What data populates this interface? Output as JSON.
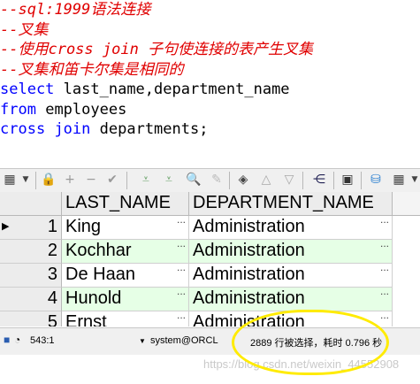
{
  "editor": {
    "lines": [
      {
        "text": "--sql:1999语法连接",
        "style": "comment"
      },
      {
        "text": "--叉集",
        "style": "comment"
      },
      {
        "text": "--使用cross join 子句使连接的表产生叉集",
        "style": "comment"
      },
      {
        "text": "--叉集和笛卡尔集是相同的",
        "style": "comment"
      },
      {
        "text": "select last_name,department_name",
        "style": "code"
      },
      {
        "text": "from employees",
        "style": "code"
      },
      {
        "text": "cross join departments;",
        "style": "code"
      }
    ],
    "comment_color": "#e00000",
    "keyword_color": "#0000ff"
  },
  "toolbar": {
    "icons": [
      "grid-menu-icon",
      "lock-icon",
      "add-record-icon",
      "delete-record-icon",
      "post-changes-icon",
      "filter-down-icon",
      "filter-clear-icon",
      "find-icon",
      "clear-icon",
      "query-by-example-icon",
      "sort-up-icon",
      "sort-down-icon",
      "explain-plan-icon",
      "save-icon",
      "export-icon",
      "more-icon"
    ]
  },
  "grid": {
    "columns": [
      "LAST_NAME",
      "DEPARTMENT_NAME"
    ],
    "rows": [
      {
        "num": "1",
        "last_name": "King",
        "department_name": "Administration"
      },
      {
        "num": "2",
        "last_name": "Kochhar",
        "department_name": "Administration"
      },
      {
        "num": "3",
        "last_name": "De Haan",
        "department_name": "Administration"
      },
      {
        "num": "4",
        "last_name": "Hunold",
        "department_name": "Administration"
      },
      {
        "num": "5",
        "last_name": "Ernst",
        "department_name": "Administration"
      }
    ],
    "ellipsis": "...",
    "alt_row_color": "#e6ffe6"
  },
  "status": {
    "position": "543:1",
    "connection": "system@ORCL",
    "message": "2889 行被选择，耗时 0.796 秒"
  },
  "watermark": "https://blog.csdn.net/weixin_44552908",
  "highlight_color": "#ffeb00"
}
